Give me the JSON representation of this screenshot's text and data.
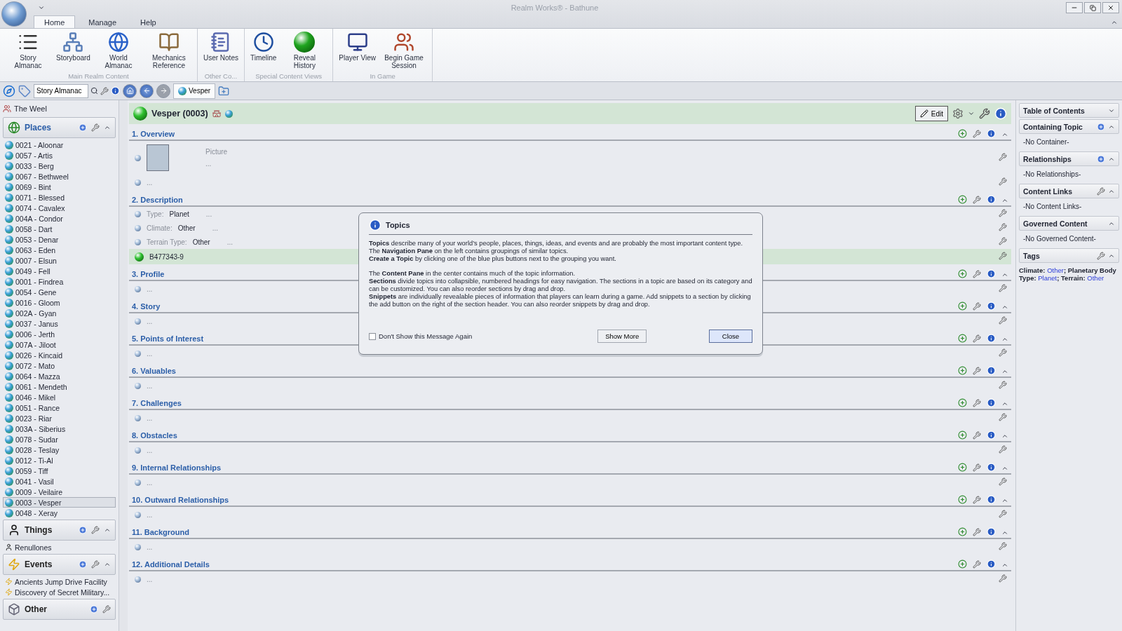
{
  "window": {
    "title": "Realm Works® - Bathune"
  },
  "ribbon": {
    "tabs": [
      {
        "label": "Home",
        "selected": true
      },
      {
        "label": "Manage",
        "selected": false
      },
      {
        "label": "Help",
        "selected": false
      }
    ],
    "groups": [
      {
        "label": "Main Realm Content",
        "buttons": [
          "Story Almanac",
          "Storyboard",
          "World Almanac",
          "Mechanics Reference"
        ]
      },
      {
        "label": "Other Co...",
        "buttons": [
          "User Notes"
        ]
      },
      {
        "label": "Special Content Views",
        "buttons": [
          "Timeline",
          "Reveal History"
        ]
      },
      {
        "label": "In Game",
        "buttons": [
          "Player View",
          "Begin Game Session"
        ]
      }
    ]
  },
  "nav_bar": {
    "search_value": "Story Almanac",
    "open_tabs": [
      {
        "label": "Vesper",
        "selected": true
      }
    ]
  },
  "navigation_pane": {
    "realm": "The Weel",
    "groups": [
      {
        "label": "Places",
        "items": [
          {
            "label": "0021 - Aloonar",
            "selected": false
          },
          {
            "label": "0057 - Artis",
            "selected": false
          },
          {
            "label": "0033 - Berg",
            "selected": false
          },
          {
            "label": "0067 - Bethweel",
            "selected": false
          },
          {
            "label": "0069 - Bint",
            "selected": false
          },
          {
            "label": "0071 - Blessed",
            "selected": false
          },
          {
            "label": "0074 - Cavalex",
            "selected": false
          },
          {
            "label": "004A - Condor",
            "selected": false
          },
          {
            "label": "0058 - Dart",
            "selected": false
          },
          {
            "label": "0053 - Denar",
            "selected": false
          },
          {
            "label": "0063 - Eden",
            "selected": false
          },
          {
            "label": "0007 - Elsun",
            "selected": false
          },
          {
            "label": "0049 - Fell",
            "selected": false
          },
          {
            "label": "0001 - Findrea",
            "selected": false
          },
          {
            "label": "0054 - Gene",
            "selected": false
          },
          {
            "label": "0016 - Gloom",
            "selected": false
          },
          {
            "label": "002A - Gyan",
            "selected": false
          },
          {
            "label": "0037 - Janus",
            "selected": false
          },
          {
            "label": "0006 - Jerth",
            "selected": false
          },
          {
            "label": "007A - Jiloot",
            "selected": false
          },
          {
            "label": "0026 - Kincaid",
            "selected": false
          },
          {
            "label": "0072 - Mato",
            "selected": false
          },
          {
            "label": "0064 - Mazza",
            "selected": false
          },
          {
            "label": "0061 - Mendeth",
            "selected": false
          },
          {
            "label": "0046 - Mikel",
            "selected": false
          },
          {
            "label": "0051 - Rance",
            "selected": false
          },
          {
            "label": "0023 - Riar",
            "selected": false
          },
          {
            "label": "003A - Siberius",
            "selected": false
          },
          {
            "label": "0078 - Sudar",
            "selected": false
          },
          {
            "label": "0028 - Teslay",
            "selected": false
          },
          {
            "label": "0012 - Ti-Al",
            "selected": false
          },
          {
            "label": "0059 - Tiff",
            "selected": false
          },
          {
            "label": "0041 - Vasil",
            "selected": false
          },
          {
            "label": "0009 - Veilaire",
            "selected": false
          },
          {
            "label": "0003 - Vesper",
            "selected": true
          },
          {
            "label": "0048 - Xeray",
            "selected": false
          }
        ]
      },
      {
        "label": "Things",
        "items": [
          {
            "label": "Renullones",
            "selected": false
          }
        ]
      },
      {
        "label": "Events",
        "items": [
          {
            "label": "Ancients Jump Drive Facility",
            "selected": false
          },
          {
            "label": "Discovery of Secret Military...",
            "selected": false
          }
        ]
      },
      {
        "label": "Other"
      }
    ]
  },
  "topic": {
    "title": "Vesper (0003)",
    "edit_button": "Edit",
    "sections": [
      {
        "title": "1. Overview",
        "snippets": [
          {
            "kind": "picture",
            "label": "Picture",
            "text": "..."
          },
          {
            "kind": "text",
            "text": "...",
            "revealed": false
          }
        ]
      },
      {
        "title": "2. Description",
        "snippets": [
          {
            "kind": "field",
            "label": "Type:",
            "value": "Planet",
            "text": "..."
          },
          {
            "kind": "field",
            "label": "Climate:",
            "value": "Other",
            "text": "..."
          },
          {
            "kind": "field",
            "label": "Terrain Type:",
            "value": "Other",
            "text": "..."
          },
          {
            "kind": "text",
            "text": "B477343-9",
            "revealed": true
          }
        ]
      },
      {
        "title": "3. Profile",
        "snippets": [
          {
            "kind": "text",
            "text": "...",
            "revealed": false
          }
        ]
      },
      {
        "title": "4. Story",
        "snippets": [
          {
            "kind": "text",
            "text": "...",
            "revealed": false
          }
        ]
      },
      {
        "title": "5. Points of Interest",
        "snippets": [
          {
            "kind": "text",
            "text": "...",
            "revealed": false
          }
        ]
      },
      {
        "title": "6. Valuables",
        "snippets": [
          {
            "kind": "text",
            "text": "...",
            "revealed": false
          }
        ]
      },
      {
        "title": "7. Challenges",
        "snippets": [
          {
            "kind": "text",
            "text": "...",
            "revealed": false
          }
        ]
      },
      {
        "title": "8. Obstacles",
        "snippets": [
          {
            "kind": "text",
            "text": "...",
            "revealed": false
          }
        ]
      },
      {
        "title": "9. Internal Relationships",
        "snippets": [
          {
            "kind": "text",
            "text": "...",
            "revealed": false
          }
        ]
      },
      {
        "title": "10. Outward Relationships",
        "snippets": [
          {
            "kind": "text",
            "text": "...",
            "revealed": false
          }
        ]
      },
      {
        "title": "11. Background",
        "snippets": [
          {
            "kind": "text",
            "text": "...",
            "revealed": false
          }
        ]
      },
      {
        "title": "12. Additional Details",
        "snippets": [
          {
            "kind": "text",
            "text": "...",
            "revealed": false
          }
        ]
      }
    ]
  },
  "dialog": {
    "title": "Topics",
    "paragraphs": [
      [
        "**Topics** describe many of your world’s people, places, things, ideas, and events and are probably the most important content type.",
        "The **Navigation Pane** on the left contains groupings of similar topics.",
        "**Create a Topic** by clicking one of the blue plus buttons next to the grouping you want."
      ],
      [
        "The **Content Pane** in the center contains much of the topic information.",
        "**Sections** divide topics into collapsible, numbered headings for easy navigation. The sections in a topic are based on its category and can be customized. You can also reorder sections by drag and drop.",
        "**Snippets** are individually revealable pieces of information that players can learn during a game. Add snippets to a section by clicking the add button on the right of the section header. You can also reorder snippets by drag and drop."
      ]
    ],
    "checkbox": {
      "label": "Don't Show this Message Again",
      "checked": false
    },
    "buttons": [
      "Show More",
      "Close"
    ]
  },
  "side_panels": [
    {
      "title": "Table of Contents",
      "expanded": false
    },
    {
      "title": "Containing Topic",
      "expanded": true,
      "text": "-No Container-"
    },
    {
      "title": "Relationships",
      "expanded": true,
      "text": "-No Relationships-"
    },
    {
      "title": "Content Links",
      "expanded": true,
      "text": "-No Content Links-"
    },
    {
      "title": "Governed Content",
      "expanded": true,
      "text": "-No Governed Content-"
    },
    {
      "title": "Tags",
      "expanded": true,
      "tags": [
        {
          "label": "Climate:",
          "value": "Other"
        },
        {
          "label": "; Planetary Body Type:",
          "value": "Planet"
        },
        {
          "label": "; Terrain:",
          "value": "Other"
        }
      ]
    }
  ]
}
